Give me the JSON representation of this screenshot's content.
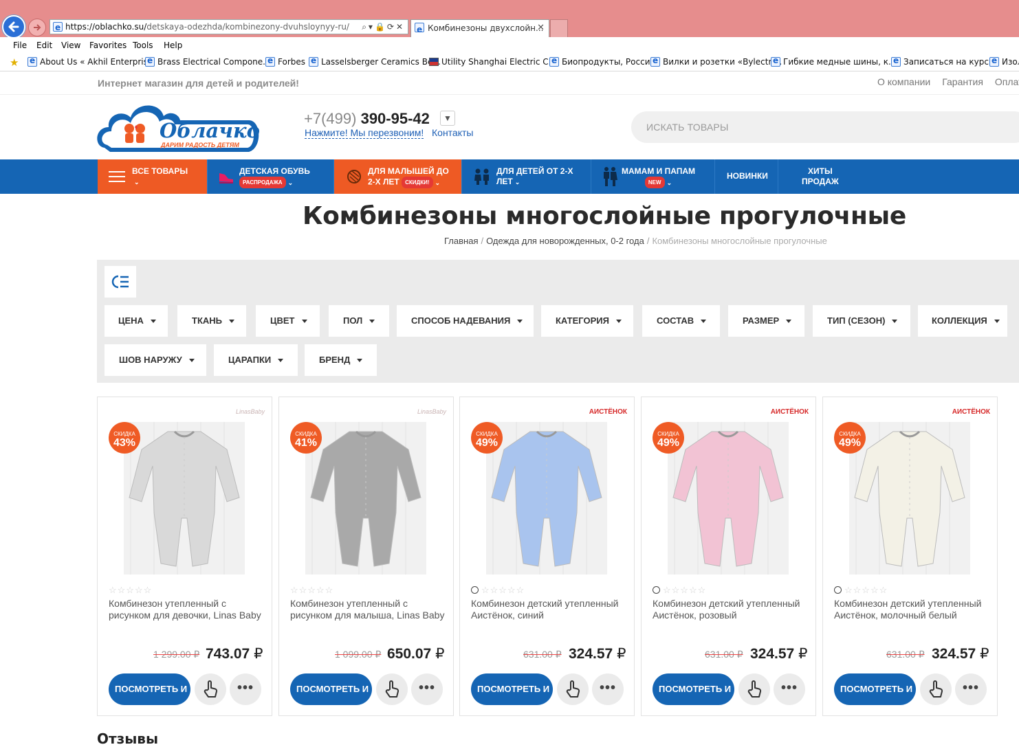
{
  "browser": {
    "address": {
      "host": "https://oblachko.su/",
      "path": "detskaya-odezhda/kombinezony-dvuhsloynyy-ru/"
    },
    "tab_title": "Комбинезоны двухслойн...",
    "menu": [
      "File",
      "Edit",
      "View",
      "Favorites",
      "Tools",
      "Help"
    ],
    "favorites": [
      "About Us « Akhil Enterprise",
      "Brass Electrical Compone...",
      "Forbes",
      "Lasselsberger Ceramics Be...",
      "Utility Shanghai Electric C...",
      "Биопродукты, Россия",
      "Вилки и розетки «Bylectri...",
      "Гибкие медные шины, к...",
      "Записаться на курсы",
      "Изол"
    ]
  },
  "site": {
    "tagline": "Интернет магазин для детей и родителей!",
    "top_links": [
      "О компании",
      "Гарантия",
      "Оплат"
    ],
    "logo": {
      "name": "Облачко",
      "slogan": "ДАРИМ РАДОСТЬ ДЕТЯМ"
    },
    "phone": {
      "code": "+7(499)",
      "number": "390-95-42"
    },
    "callback": "Нажмите! Мы перезвоним!",
    "contacts": "Контакты",
    "search_placeholder": "ИСКАТЬ ТОВАРЫ"
  },
  "nav": {
    "all": "ВСЕ ТОВАРЫ",
    "shoes": "ДЕТСКАЯ ОБУВЬ",
    "shoes_badge": "РАСПРОДАЖА",
    "babies_1": "ДЛЯ МАЛЫШЕЙ ДО",
    "babies_2": "2-Х ЛЕТ",
    "babies_badge": "СКИДКИ!",
    "kids_1": "ДЛЯ ДЕТЕЙ ОТ 2-Х",
    "kids_2": "ЛЕТ",
    "parents": "МАМАМ И ПАПАМ",
    "parents_badge": "NEW",
    "new": "НОВИНКИ",
    "hits_1": "ХИТЫ",
    "hits_2": "ПРОДАЖ"
  },
  "page": {
    "title": "Комбинезоны многослойные прогулочные",
    "breadcrumb": [
      "Главная",
      "Одежда для новорожденных, 0-2 года",
      "Комбинезоны многослойные прогулочные"
    ]
  },
  "filters": [
    "ЦЕНА",
    "ТКАНЬ",
    "ЦВЕТ",
    "ПОЛ",
    "СПОСОБ НАДЕВАНИЯ",
    "КАТЕГОРИЯ",
    "СОСТАВ",
    "РАЗМЕР",
    "ТИП (СЕЗОН)",
    "КОЛЛЕКЦИЯ",
    "ШОВ НАРУЖУ",
    "ЦАРАПКИ",
    "БРЕНД"
  ],
  "products": [
    {
      "brand": "LinasBaby",
      "discount_label": "СКИДКА",
      "discount": "43%",
      "name": "Комбинезон утепленный с рисунком для девочки, Linas Baby",
      "old_price": "1 299.00 ₽",
      "price": "743.07",
      "currency": "₽",
      "buy": "ПОСМОТРЕТЬ И",
      "color": "#d9d9d9"
    },
    {
      "brand": "LinasBaby",
      "discount_label": "СКИДКА",
      "discount": "41%",
      "name": "Комбинезон утепленный с рисунком для малыша, Linas Baby",
      "old_price": "1 099.00 ₽",
      "price": "650.07",
      "currency": "₽",
      "buy": "ПОСМОТРЕТЬ И",
      "color": "#a9a9a9"
    },
    {
      "brand": "АИСТЁНОК",
      "discount_label": "СКИДКА",
      "discount": "49%",
      "name": "Комбинезон детский утепленный Аистёнок, синий",
      "old_price": "631.00 ₽",
      "price": "324.57",
      "currency": "₽",
      "buy": "ПОСМОТРЕТЬ И",
      "color": "#a9c4ee"
    },
    {
      "brand": "АИСТЁНОК",
      "discount_label": "СКИДКА",
      "discount": "49%",
      "name": "Комбинезон детский утепленный Аистёнок, розовый",
      "old_price": "631.00 ₽",
      "price": "324.57",
      "currency": "₽",
      "buy": "ПОСМОТРЕТЬ И",
      "color": "#f2c3d4"
    },
    {
      "brand": "АИСТЁНОК",
      "discount_label": "СКИДКА",
      "discount": "49%",
      "name": "Комбинезон детский утепленный Аистёнок, молочный белый",
      "old_price": "631.00 ₽",
      "price": "324.57",
      "currency": "₽",
      "buy": "ПОСМОТРЕТЬ И",
      "color": "#f3f1e6"
    }
  ],
  "reviews_heading": "Отзывы"
}
